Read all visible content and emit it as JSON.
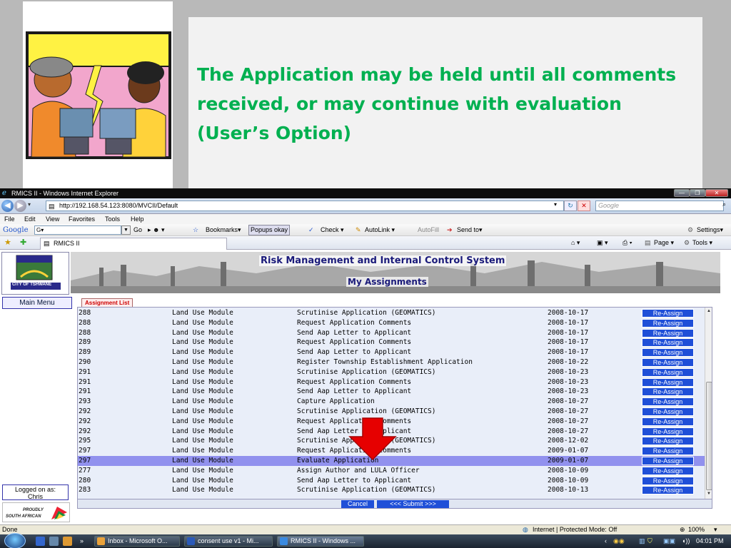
{
  "slide": {
    "heading_lines": [
      "The Application may be held until all comments",
      "received, or may continue with evaluation",
      "(User’s Option)"
    ]
  },
  "window": {
    "title": "RMICS II - Windows Internet Explorer",
    "controls": {
      "minimize": "—",
      "maximize": "❐",
      "close": "✕"
    }
  },
  "address_bar": {
    "url": "http://192.168.54.123:8080/MVCII/Default",
    "search_placeholder": "Google"
  },
  "menu": [
    "File",
    "Edit",
    "View",
    "Favorites",
    "Tools",
    "Help"
  ],
  "google_toolbar": {
    "logo": "Google",
    "search_value": "G▾",
    "go": "Go",
    "bookmarks": "Bookmarks▾",
    "popups": "Popups okay",
    "check": "Check ▾",
    "autolink": "AutoLink ▾",
    "autofill": "AutoFill",
    "send_to": "Send to▾",
    "settings": "Settings▾"
  },
  "favorites_bar": {
    "tab_title": "RMICS II",
    "page_menu": "Page ▾",
    "tools_menu": "Tools ▾"
  },
  "app": {
    "logo_caption": "CITY OF TSHWANE",
    "system_title": "Risk Management and Internal Control System",
    "page_title": "My Assignments",
    "main_menu": "Main Menu",
    "list_tab": "Assignment List",
    "logged_on_label": "Logged on as:",
    "logged_on_user": "Chris",
    "proudly_line1": "PROUDLY",
    "proudly_line2": "SOUTH AFRICAN",
    "reassign_label": "Re-Assign",
    "cancel_label": "Cancel",
    "submit_label": "<<< Submit >>>",
    "selected_row": 15,
    "assignments": [
      {
        "id": "288",
        "module": "Land Use Module",
        "task": "Scrutinise Application (GEOMATICS)",
        "date": "2008-10-17"
      },
      {
        "id": "288",
        "module": "Land Use Module",
        "task": "Request Application Comments",
        "date": "2008-10-17"
      },
      {
        "id": "288",
        "module": "Land Use Module",
        "task": "Send Aap Letter to Applicant",
        "date": "2008-10-17"
      },
      {
        "id": "289",
        "module": "Land Use Module",
        "task": "Request Application Comments",
        "date": "2008-10-17"
      },
      {
        "id": "289",
        "module": "Land Use Module",
        "task": "Send Aap Letter to Applicant",
        "date": "2008-10-17"
      },
      {
        "id": "290",
        "module": "Land Use Module",
        "task": "Register Township Establishment Application",
        "date": "2008-10-22"
      },
      {
        "id": "291",
        "module": "Land Use Module",
        "task": "Scrutinise Application (GEOMATICS)",
        "date": "2008-10-23"
      },
      {
        "id": "291",
        "module": "Land Use Module",
        "task": "Request Application Comments",
        "date": "2008-10-23"
      },
      {
        "id": "291",
        "module": "Land Use Module",
        "task": "Send Aap Letter to Applicant",
        "date": "2008-10-23"
      },
      {
        "id": "293",
        "module": "Land Use Module",
        "task": "Capture Application",
        "date": "2008-10-27"
      },
      {
        "id": "292",
        "module": "Land Use Module",
        "task": "Scrutinise Application (GEOMATICS)",
        "date": "2008-10-27"
      },
      {
        "id": "292",
        "module": "Land Use Module",
        "task": "Request Application Comments",
        "date": "2008-10-27"
      },
      {
        "id": "292",
        "module": "Land Use Module",
        "task": "Send Aap Letter to Applicant",
        "date": "2008-10-27"
      },
      {
        "id": "295",
        "module": "Land Use Module",
        "task": "Scrutinise Application (GEOMATICS)",
        "date": "2008-12-02"
      },
      {
        "id": "297",
        "module": "Land Use Module",
        "task": "Request Application Comments",
        "date": "2009-01-07"
      },
      {
        "id": "297",
        "module": "Land Use Module",
        "task": "Evaluate Application",
        "date": "2009-01-07"
      },
      {
        "id": "277",
        "module": "Land Use Module",
        "task": "Assign Author and LULA Officer",
        "date": "2008-10-09"
      },
      {
        "id": "280",
        "module": "Land Use Module",
        "task": "Send Aap Letter to Applicant",
        "date": "2008-10-09"
      },
      {
        "id": "283",
        "module": "Land Use Module",
        "task": "Scrutinise Application (GEOMATICS)",
        "date": "2008-10-13"
      }
    ]
  },
  "status_bar": {
    "left": "Done",
    "zone": "Internet | Protected Mode: Off",
    "zoom": "100%"
  },
  "taskbar": {
    "tasks": [
      "Inbox - Microsoft O...",
      "consent use v1 - Mi...",
      "RMICS II - Windows ..."
    ],
    "clock": "04:01 PM"
  },
  "colors": {
    "slide_text": "#00b050",
    "selected_row": "#9191ee",
    "button_blue": "#1f4fd8",
    "arrow_red": "#e60000"
  }
}
